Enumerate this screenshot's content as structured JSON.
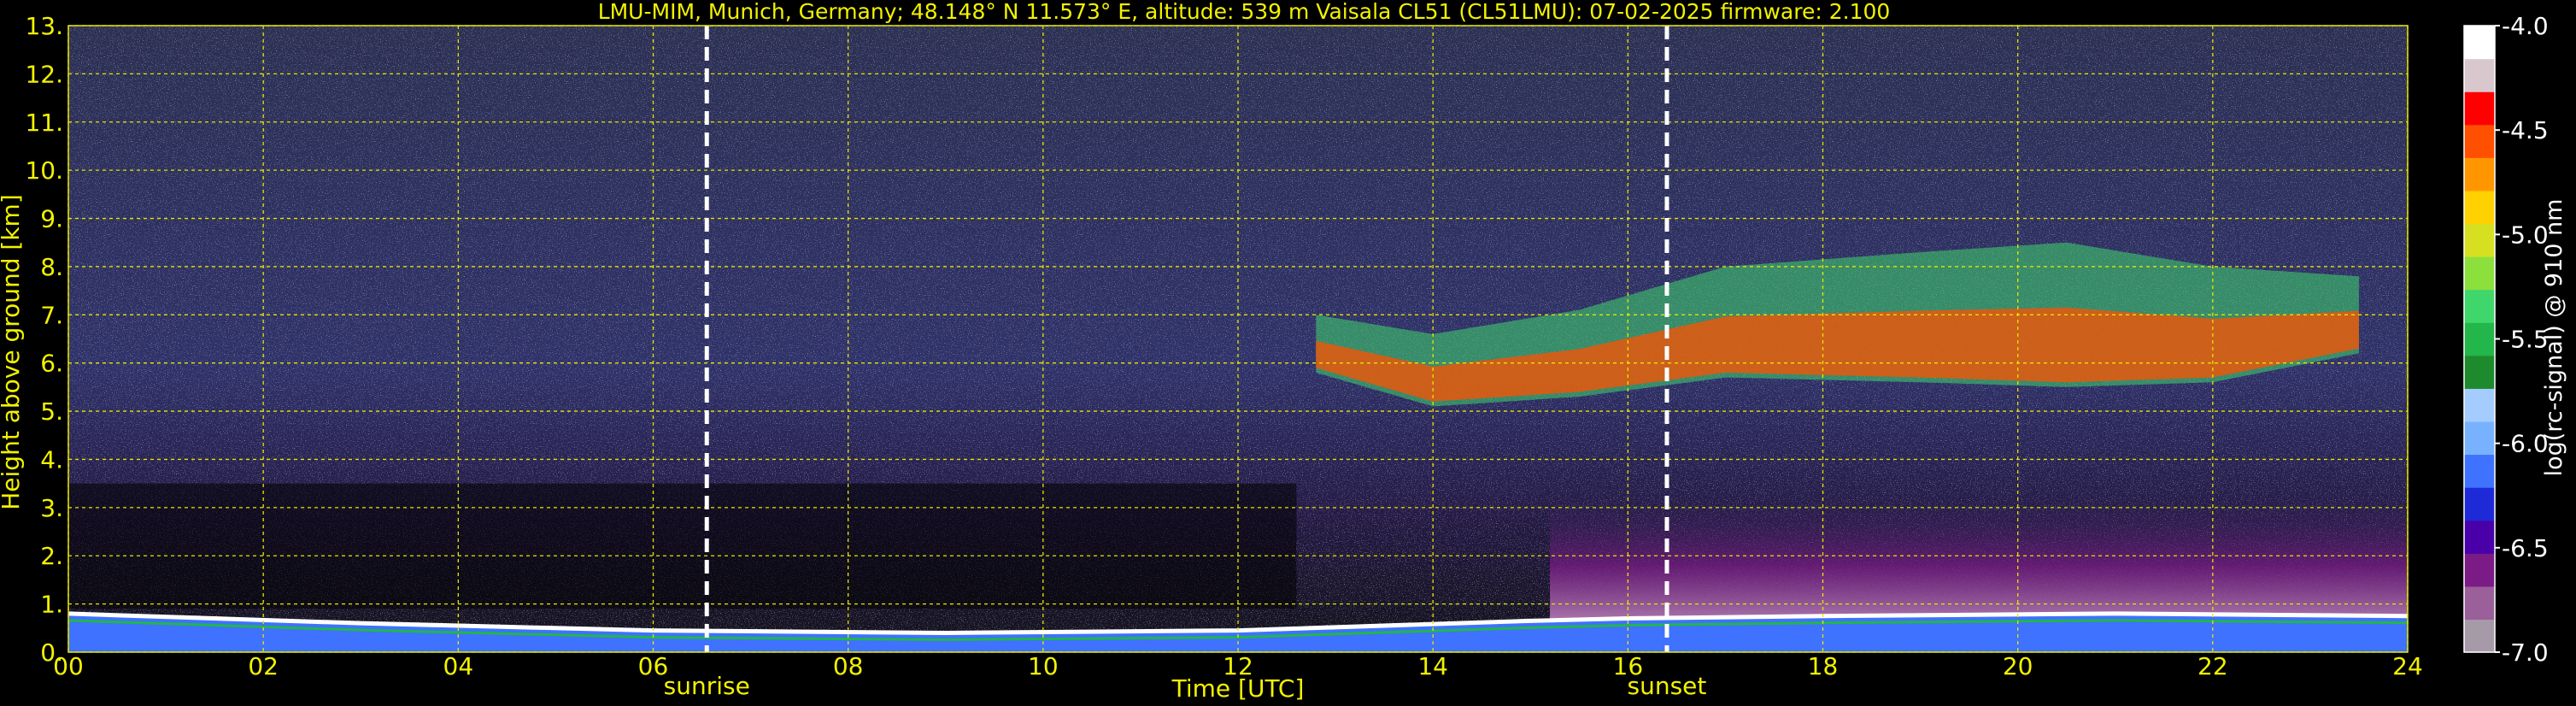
{
  "chart_data": {
    "type": "heatmap",
    "title": "LMU-MIM, Munich, Germany; 48.148° N 11.573° E, altitude: 539 m    Vaisala CL51 (CL51LMU): 07-02-2025    firmware: 2.100",
    "xlabel": "Time [UTC]",
    "ylabel": "Height above ground [km]",
    "xlim": [
      0,
      24
    ],
    "ylim": [
      0,
      13
    ],
    "x_ticks": [
      "00",
      "02",
      "04",
      "06",
      "08",
      "10",
      "12",
      "14",
      "16",
      "18",
      "20",
      "22",
      "24"
    ],
    "x_tick_values": [
      0,
      2,
      4,
      6,
      8,
      10,
      12,
      14,
      16,
      18,
      20,
      22,
      24
    ],
    "y_ticks": [
      "0.",
      "1.",
      "2.",
      "3.",
      "4.",
      "5.",
      "6.",
      "7.",
      "8.",
      "9.",
      "10.",
      "11.",
      "12.",
      "13."
    ],
    "y_tick_values": [
      0,
      1,
      2,
      3,
      4,
      5,
      6,
      7,
      8,
      9,
      10,
      11,
      12,
      13
    ],
    "grid": true,
    "annotations": [
      {
        "label": "sunrise",
        "x": 6.55
      },
      {
        "label": "sunset",
        "x": 16.4
      }
    ],
    "colorbar": {
      "label": "log(rc-signal) @ 910 nm",
      "range": [
        -7.0,
        -4.0
      ],
      "ticks": [
        "-4.0",
        "-4.5",
        "-5.0",
        "-5.5",
        "-6.0",
        "-6.5",
        "-7.0"
      ],
      "tick_values": [
        -4.0,
        -4.5,
        -5.0,
        -5.5,
        -6.0,
        -6.5,
        -7.0
      ]
    },
    "features": {
      "boundary_layer_top_km": [
        {
          "x": 0,
          "y": 0.8
        },
        {
          "x": 3,
          "y": 0.6
        },
        {
          "x": 6,
          "y": 0.45
        },
        {
          "x": 9,
          "y": 0.4
        },
        {
          "x": 12,
          "y": 0.45
        },
        {
          "x": 15,
          "y": 0.65
        },
        {
          "x": 16,
          "y": 0.7
        },
        {
          "x": 18,
          "y": 0.75
        },
        {
          "x": 21,
          "y": 0.8
        },
        {
          "x": 24,
          "y": 0.75
        }
      ],
      "cirrus_layer_km": [
        {
          "x": 12.8,
          "base": 5.8,
          "top": 7.0
        },
        {
          "x": 14.0,
          "base": 5.1,
          "top": 6.6
        },
        {
          "x": 15.5,
          "base": 5.3,
          "top": 7.1
        },
        {
          "x": 17.0,
          "base": 5.7,
          "top": 8.0
        },
        {
          "x": 19.0,
          "base": 5.6,
          "top": 8.3
        },
        {
          "x": 20.5,
          "base": 5.5,
          "top": 8.5
        },
        {
          "x": 22.0,
          "base": 5.6,
          "top": 8.0
        },
        {
          "x": 23.5,
          "base": 6.2,
          "top": 7.8
        }
      ]
    }
  },
  "colors": {
    "text": "#f2f200",
    "background": "#000000",
    "colormap": [
      "#a69aa8",
      "#9b5f99",
      "#7a1b86",
      "#4a00a8",
      "#1e2ad8",
      "#3e72ff",
      "#78b2ff",
      "#a5ccff",
      "#1e8a2e",
      "#23b64a",
      "#3fd66b",
      "#8ce03c",
      "#d6e020",
      "#ffd100",
      "#ff9600",
      "#ff5000",
      "#ff0000",
      "#d9c7ce",
      "#ffffff"
    ]
  }
}
